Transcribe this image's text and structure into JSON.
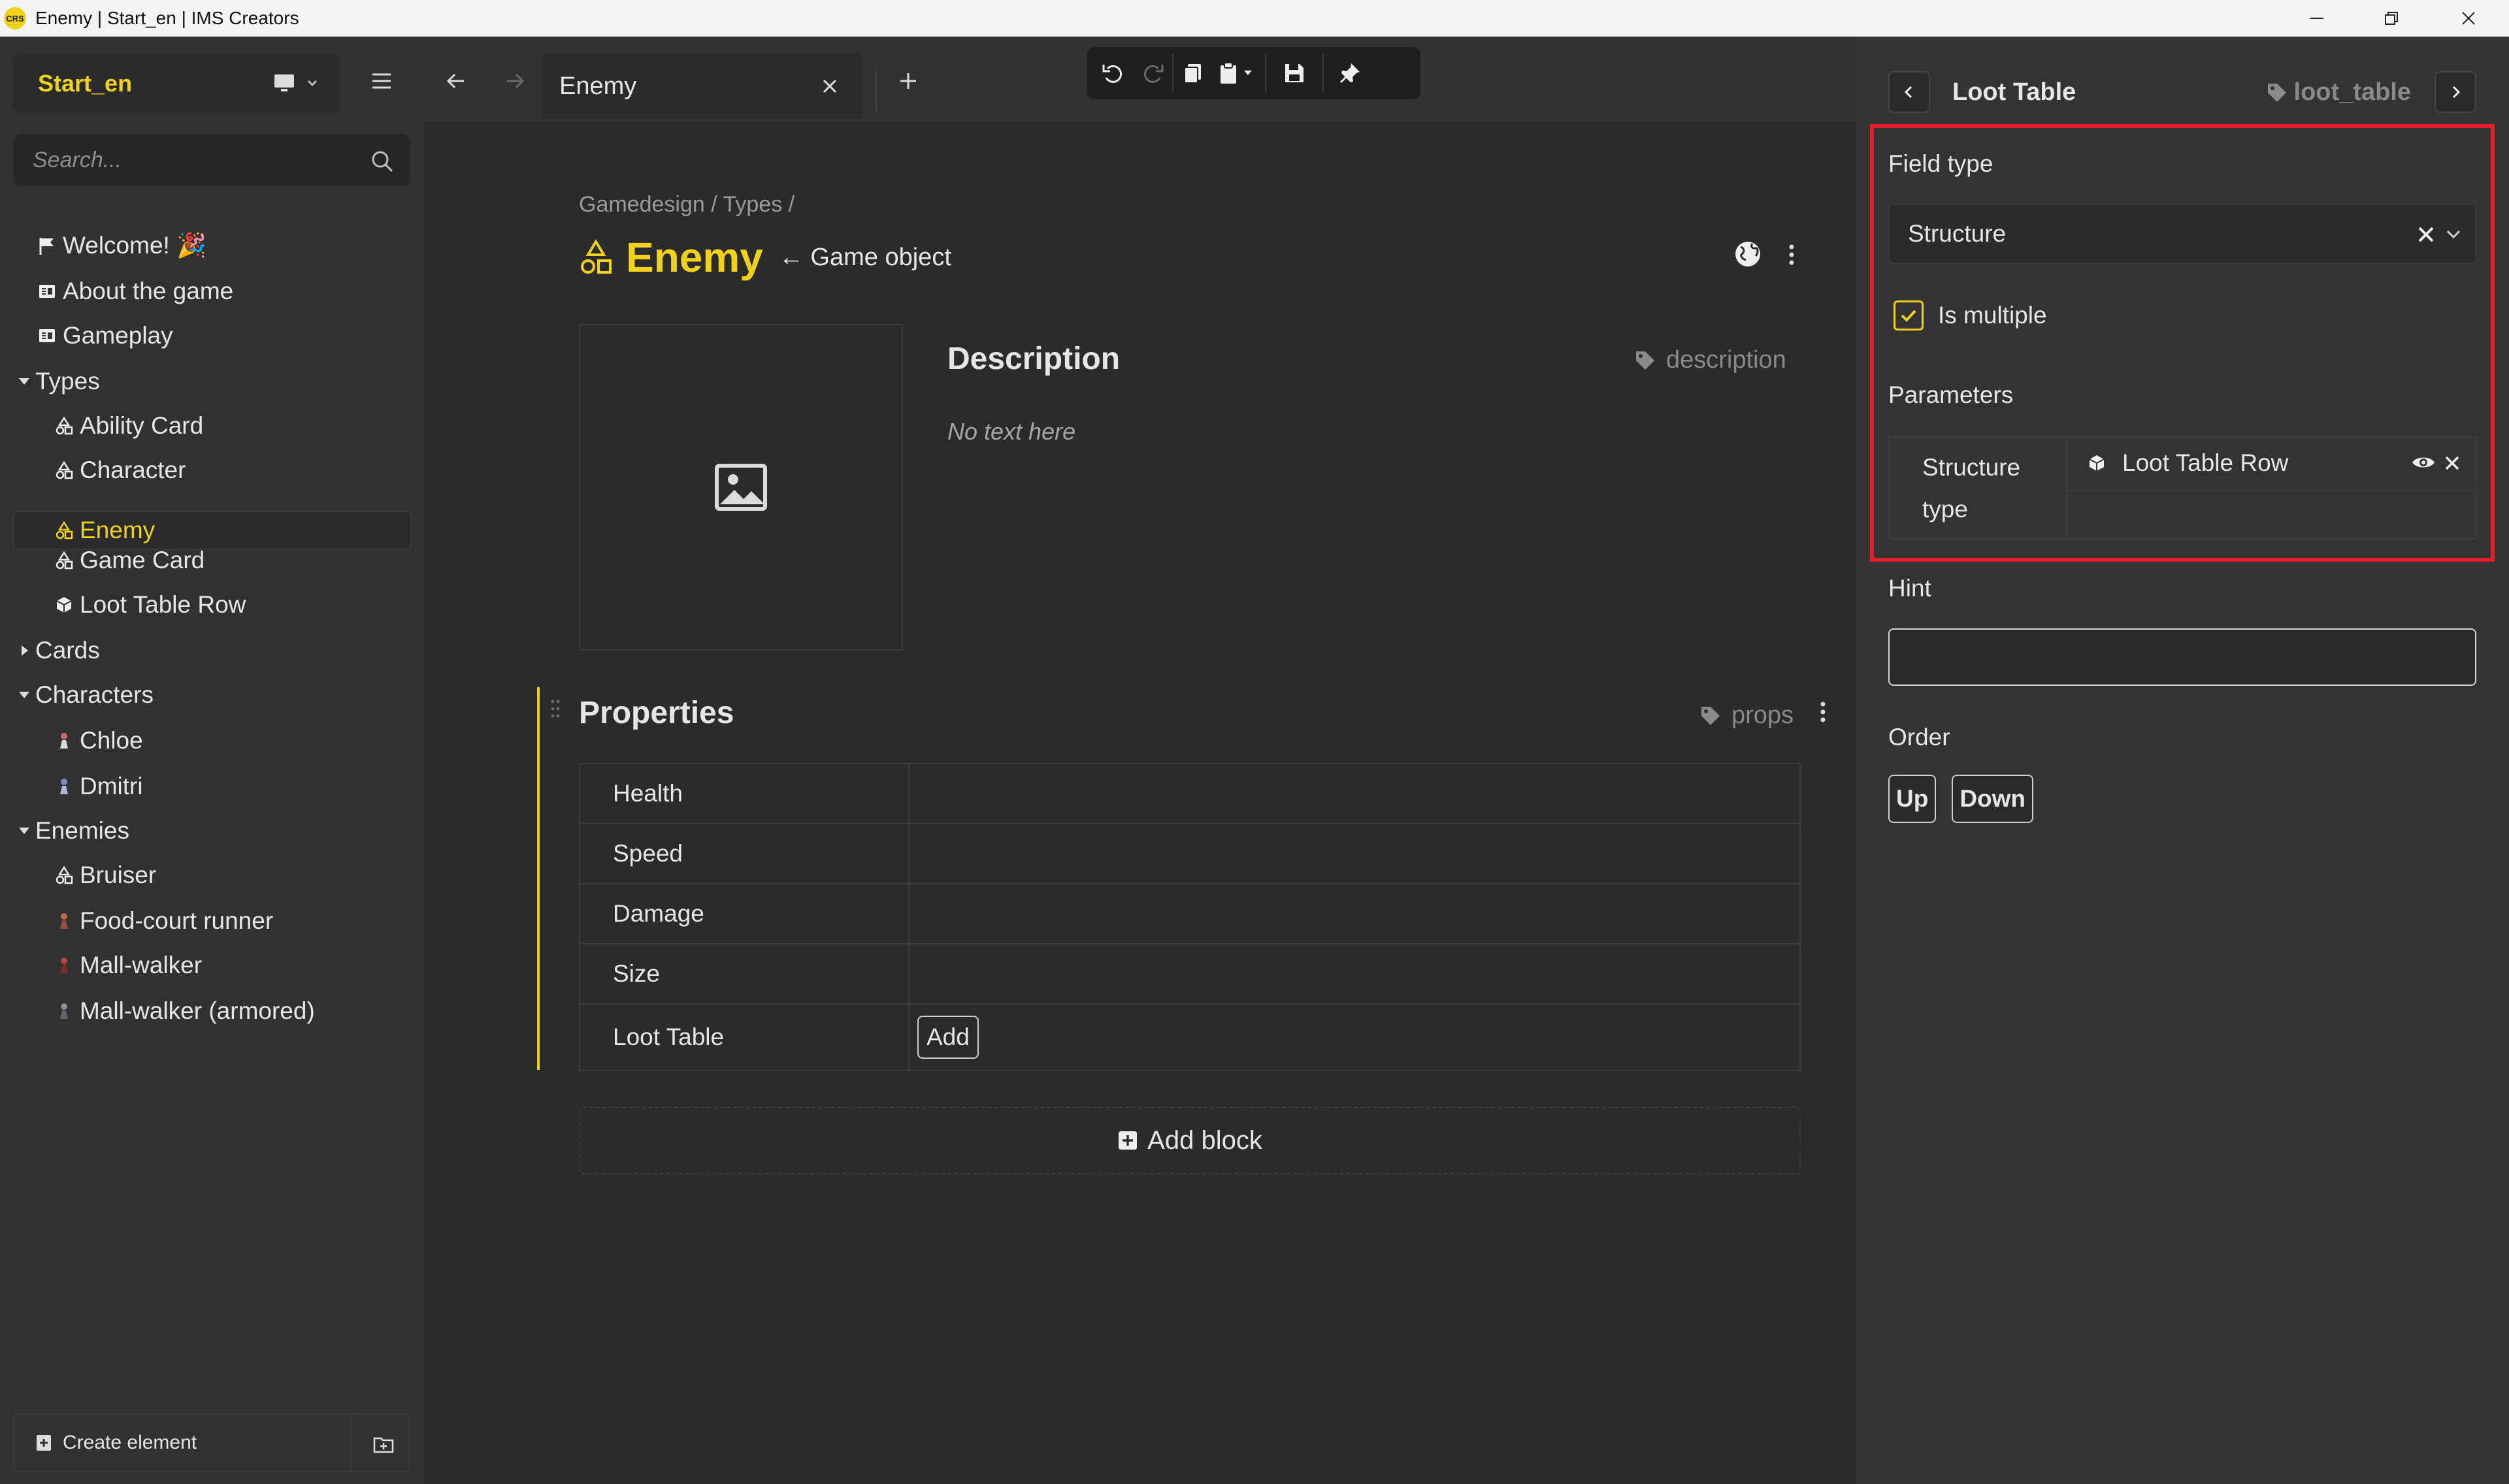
{
  "window": {
    "logo_text": "CRS",
    "title": "Enemy | Start_en | IMS Creators"
  },
  "sidebar": {
    "project_name": "Start_en",
    "search": {
      "placeholder": "Search..."
    },
    "tree": [
      {
        "label": "Welcome! 🎉",
        "icon": "flag-icon"
      },
      {
        "label": "About the game",
        "icon": "document-icon"
      },
      {
        "label": "Gameplay",
        "icon": "document-icon"
      },
      {
        "label": "Types",
        "icon": "caret-down-icon"
      },
      {
        "label": "Ability Card",
        "icon": "shapes-icon"
      },
      {
        "label": "Character",
        "icon": "shapes-icon"
      },
      {
        "label": "Enemy",
        "icon": "shapes-icon",
        "active": true
      },
      {
        "label": "Game Card",
        "icon": "shapes-icon"
      },
      {
        "label": "Loot Table Row",
        "icon": "cube-icon"
      },
      {
        "label": "Cards",
        "icon": "caret-right-icon"
      },
      {
        "label": "Characters",
        "icon": "caret-down-icon"
      },
      {
        "label": "Chloe",
        "icon": "character-sprite-icon"
      },
      {
        "label": "Dmitri",
        "icon": "character-sprite-icon"
      },
      {
        "label": "Enemies",
        "icon": "caret-down-icon"
      },
      {
        "label": "Bruiser",
        "icon": "shapes-icon"
      },
      {
        "label": "Food-court runner",
        "icon": "character-sprite-icon"
      },
      {
        "label": "Mall-walker",
        "icon": "character-sprite-icon"
      },
      {
        "label": "Mall-walker (armored)",
        "icon": "character-sprite-icon"
      }
    ],
    "create_element_label": "Create element"
  },
  "tabs": [
    {
      "label": "Enemy",
      "active": true
    }
  ],
  "main": {
    "breadcrumb": "Gamedesign / Types /",
    "title": "Enemy",
    "parent": "← Game object",
    "description": {
      "title": "Description",
      "key": "description",
      "empty_text": "No text here"
    },
    "properties": {
      "title": "Properties",
      "key": "props",
      "rows": [
        {
          "name": "Health",
          "value": ""
        },
        {
          "name": "Speed",
          "value": ""
        },
        {
          "name": "Damage",
          "value": ""
        },
        {
          "name": "Size",
          "value": ""
        },
        {
          "name": "Loot Table",
          "value": "",
          "action": "Add"
        }
      ]
    },
    "add_block_label": "Add block"
  },
  "right_panel": {
    "title": "Loot Table",
    "key": "loot_table",
    "field_type_label": "Field type",
    "field_type_value": "Structure",
    "is_multiple_label": "Is multiple",
    "is_multiple_checked": true,
    "parameters_label": "Parameters",
    "parameters": {
      "key_line1": "Structure",
      "key_line2": "type",
      "value": "Loot Table Row"
    },
    "hint_label": "Hint",
    "hint_value": "",
    "order_label": "Order",
    "order_up": "Up",
    "order_down": "Down"
  },
  "colors": {
    "accent": "#f0d21a",
    "highlight": "#e0202a",
    "background": "#2b2b2b"
  }
}
